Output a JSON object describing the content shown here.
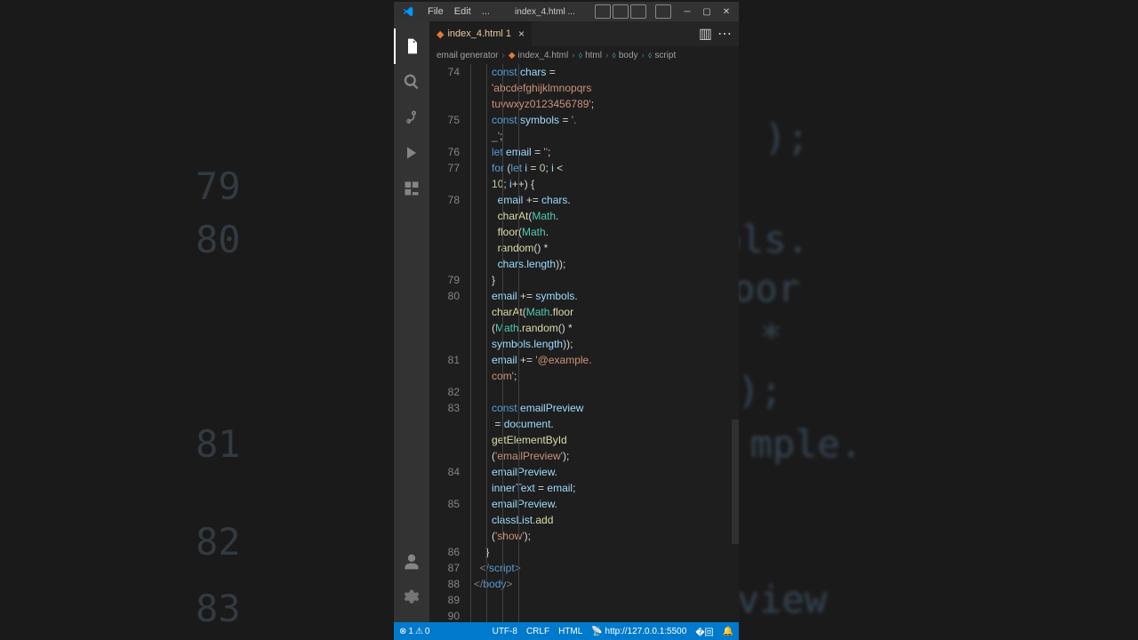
{
  "window": {
    "menus": [
      "File",
      "Edit",
      "..."
    ],
    "title": "index_4.html ..."
  },
  "tab": {
    "name": "index_4.html 1"
  },
  "breadcrumb": {
    "items": [
      "email generator",
      "index_4.html",
      "html",
      "body",
      "script"
    ]
  },
  "lines": [
    {
      "num": "74",
      "indent": 3
    },
    {
      "num": "",
      "indent": 3
    },
    {
      "num": "",
      "indent": 3
    },
    {
      "num": "75",
      "indent": 3
    },
    {
      "num": "",
      "indent": 3
    },
    {
      "num": "76",
      "indent": 3
    },
    {
      "num": "77",
      "indent": 3
    },
    {
      "num": "",
      "indent": 3
    },
    {
      "num": "78",
      "indent": 4
    },
    {
      "num": "",
      "indent": 4
    },
    {
      "num": "",
      "indent": 4
    },
    {
      "num": "",
      "indent": 4
    },
    {
      "num": "",
      "indent": 4
    },
    {
      "num": "79",
      "indent": 3
    },
    {
      "num": "80",
      "indent": 3
    },
    {
      "num": "",
      "indent": 3
    },
    {
      "num": "",
      "indent": 3
    },
    {
      "num": "",
      "indent": 3
    },
    {
      "num": "81",
      "indent": 3
    },
    {
      "num": "",
      "indent": 3
    },
    {
      "num": "82",
      "indent": 3
    },
    {
      "num": "83",
      "indent": 3
    },
    {
      "num": "",
      "indent": 3
    },
    {
      "num": "",
      "indent": 3
    },
    {
      "num": "",
      "indent": 3
    },
    {
      "num": "84",
      "indent": 3
    },
    {
      "num": "",
      "indent": 3
    },
    {
      "num": "85",
      "indent": 3
    },
    {
      "num": "",
      "indent": 3
    },
    {
      "num": "",
      "indent": 3
    },
    {
      "num": "86",
      "indent": 2
    },
    {
      "num": "87",
      "indent": 1
    },
    {
      "num": "88",
      "indent": 0
    },
    {
      "num": "89",
      "indent": 0
    },
    {
      "num": "90",
      "indent": 0
    }
  ],
  "code": {
    "l74a": "const",
    "l74b": "chars",
    "l74c": " =",
    "l74d": "'abcdefghijklmnopqrs",
    "l74e": "tuvwxyz0123456789'",
    "l74f": ";",
    "l75a": "const",
    "l75b": "symbols",
    "l75c": " = ",
    "l75d": "'.",
    "l75e": "_'",
    "l75f": ";",
    "l76a": "let",
    "l76b": "email",
    "l76c": " = ",
    "l76d": "''",
    "l76e": ";",
    "l77a": "for",
    "l77b": " (",
    "l77c": "let",
    "l77d": "i",
    "l77e": " = ",
    "l77f": "0",
    "l77g": "; ",
    "l77h": "i",
    "l77i": " < ",
    "l77j": "10",
    "l77k": "; ",
    "l77l": "i",
    "l77m": "++) {",
    "l78a": "email",
    "l78b": " += ",
    "l78c": "chars",
    "l78d": ".",
    "l78e": "charAt",
    "l78f": "(",
    "l78g": "Math",
    "l78h": ".",
    "l78i": "floor",
    "l78j": "(",
    "l78k": "Math",
    "l78l": ".",
    "l78m": "random",
    "l78n": "() * ",
    "l78o": "chars",
    "l78p": ".",
    "l78q": "length",
    "l78r": "));",
    "l79a": "}",
    "l80a": "email",
    "l80b": " += ",
    "l80c": "symbols",
    "l80d": ".",
    "l80e": "charAt",
    "l80f": "(",
    "l80g": "Math",
    "l80h": ".",
    "l80i": "floor",
    "l80j": "(",
    "l80k": "Math",
    "l80l": ".",
    "l80m": "random",
    "l80n": "() * ",
    "l80o": "symbols",
    "l80p": ".",
    "l80q": "length",
    "l80r": "));",
    "l81a": "email",
    "l81b": " += ",
    "l81c": "'@example.",
    "l81d": "com'",
    "l81e": ";",
    "l83a": "const",
    "l83b": "emailPreview",
    "l83c": " = ",
    "l83d": "document",
    "l83e": ".",
    "l83f": "getElementById",
    "l83g": "(",
    "l83h": "'emailPreview'",
    "l83i": ");",
    "l84a": "emailPreview",
    "l84b": ".",
    "l84c": "innerText",
    "l84d": " = ",
    "l84e": "email",
    "l84f": ";",
    "l85a": "emailPreview",
    "l85b": ".",
    "l85c": "classList",
    "l85d": ".",
    "l85e": "add",
    "l85f": "(",
    "l85g": "'show'",
    "l85h": ");",
    "l86a": "}",
    "l87a": "</",
    "l87b": "script",
    "l87c": ">",
    "l88a": "</",
    "l88b": "body",
    "l88c": ">"
  },
  "status": {
    "errors": "1",
    "warnings": "0",
    "encoding": "UTF-8",
    "eol": "CRLF",
    "lang": "HTML",
    "port": "http://127.0.0.1:5500"
  },
  "bg": {
    "n1": "79",
    "n2": "80",
    "n3": "81",
    "n4": "82",
    "n5": "83",
    "t1": ");",
    "t2": "ols.",
    "t3": "oor",
    "t4": " * ",
    "t5": ");",
    "t6": "mple.",
    "t7": "view"
  }
}
